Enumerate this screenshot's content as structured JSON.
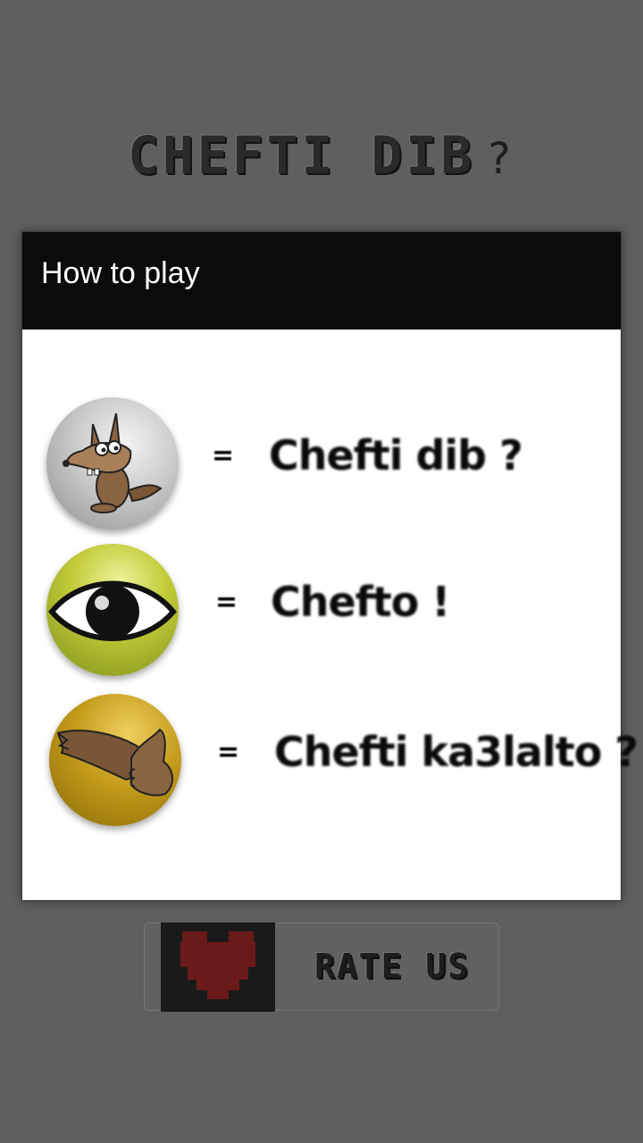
{
  "app": {
    "title": "CHEFTI DIB",
    "title_mark": "?"
  },
  "dialog": {
    "title": "How to play",
    "rows": [
      {
        "icon": "coyote-icon",
        "equals": "=",
        "phrase": "Chefti dib ?"
      },
      {
        "icon": "eye-icon",
        "equals": "=",
        "phrase": "Chefto !"
      },
      {
        "icon": "tail-hand-icon",
        "equals": "=",
        "phrase": "Chefti ka3lalto ?"
      }
    ]
  },
  "rate": {
    "label": "RATE US",
    "icon": "heart-icon"
  },
  "colors": {
    "background": "#5f5f5f",
    "dialog_header": "#0b0b0b",
    "dialog_body": "#ffffff",
    "heart": "#6b1a1a",
    "coyote_circle": "#b5b5b5",
    "eye_circle": "#a7b52a",
    "tail_circle": "#b38a14"
  }
}
